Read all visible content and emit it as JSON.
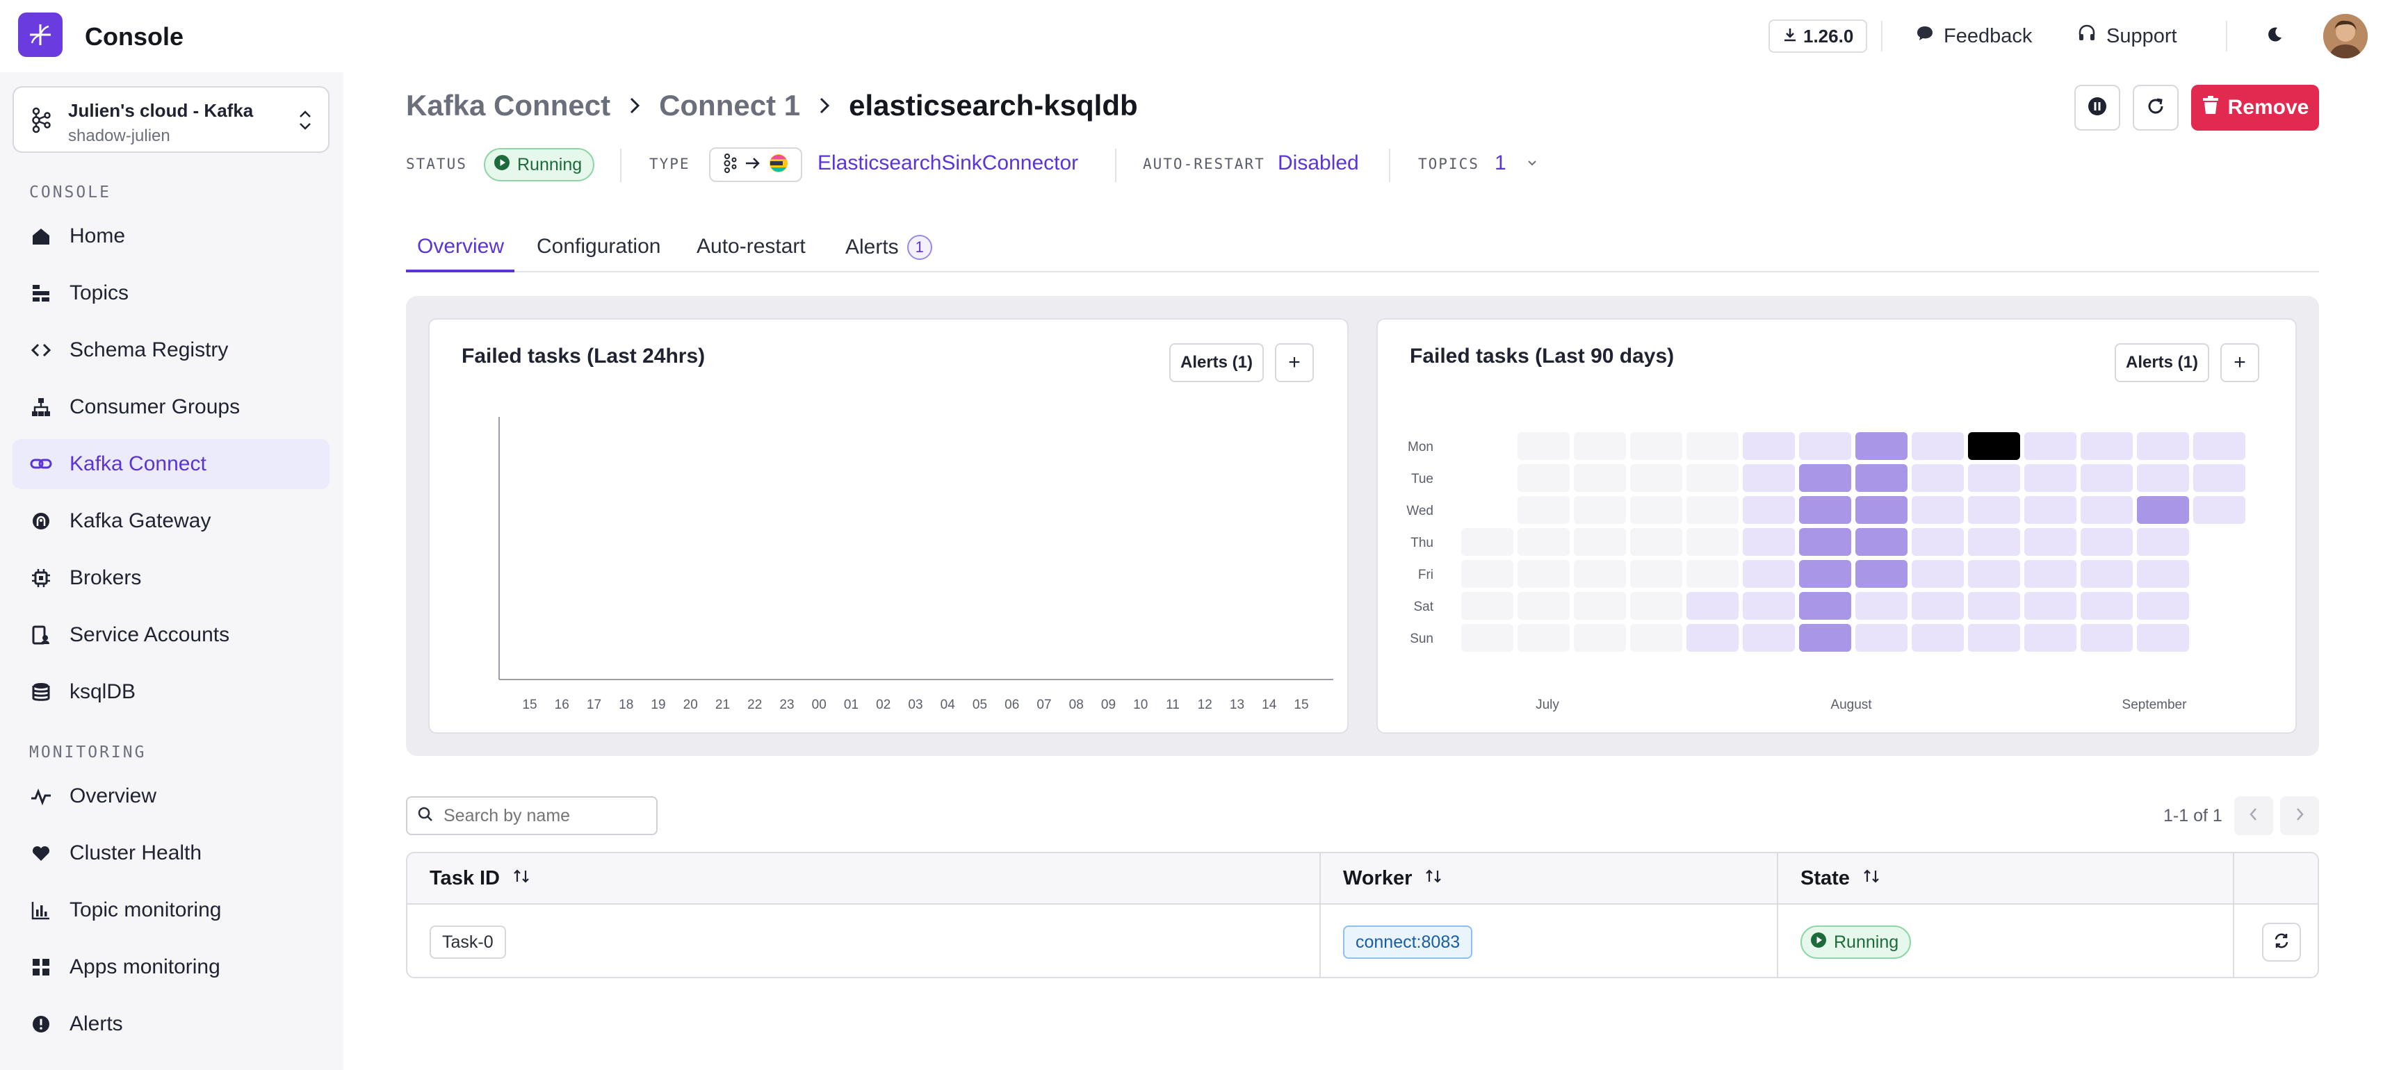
{
  "app": {
    "title": "Console"
  },
  "topbar": {
    "version": "1.26.0",
    "feedback": "Feedback",
    "support": "Support"
  },
  "cluster": {
    "name": "Julien's cloud - Kafka",
    "sub": "shadow-julien"
  },
  "sidebar": {
    "console_section": "CONSOLE",
    "console_items": [
      {
        "label": "Home",
        "icon": "home-icon"
      },
      {
        "label": "Topics",
        "icon": "topics-icon"
      },
      {
        "label": "Schema Registry",
        "icon": "code-icon"
      },
      {
        "label": "Consumer Groups",
        "icon": "hierarchy-icon"
      },
      {
        "label": "Kafka Connect",
        "icon": "link-icon",
        "active": true
      },
      {
        "label": "Kafka Gateway",
        "icon": "gateway-icon"
      },
      {
        "label": "Brokers",
        "icon": "chip-icon"
      },
      {
        "label": "Service Accounts",
        "icon": "account-icon"
      },
      {
        "label": "ksqlDB",
        "icon": "database-icon"
      }
    ],
    "monitoring_section": "MONITORING",
    "monitoring_items": [
      {
        "label": "Overview",
        "icon": "pulse-icon"
      },
      {
        "label": "Cluster Health",
        "icon": "heart-icon"
      },
      {
        "label": "Topic monitoring",
        "icon": "bar-chart-icon"
      },
      {
        "label": "Apps monitoring",
        "icon": "grid-icon"
      },
      {
        "label": "Alerts",
        "icon": "alert-icon"
      }
    ]
  },
  "breadcrumb": {
    "root": "Kafka Connect",
    "parent": "Connect 1",
    "current": "elasticsearch-ksqldb"
  },
  "header_actions": {
    "remove": "Remove"
  },
  "meta": {
    "status_label": "STATUS",
    "status_value": "Running",
    "type_label": "TYPE",
    "type_value": "ElasticsearchSinkConnector",
    "autorestart_label": "AUTO-RESTART",
    "autorestart_value": "Disabled",
    "topics_label": "TOPICS",
    "topics_value": "1"
  },
  "tabs": [
    {
      "label": "Overview",
      "active": true
    },
    {
      "label": "Configuration"
    },
    {
      "label": "Auto-restart"
    },
    {
      "label": "Alerts",
      "badge": "1"
    }
  ],
  "chart24": {
    "title": "Failed tasks (Last 24hrs)",
    "alerts_btn": "Alerts (1)",
    "add_btn": "+"
  },
  "chart90": {
    "title": "Failed tasks (Last 90 days)",
    "alerts_btn": "Alerts (1)",
    "add_btn": "+"
  },
  "chart_data": [
    {
      "type": "line",
      "title": "Failed tasks (Last 24hrs)",
      "x": [
        "15",
        "16",
        "17",
        "18",
        "19",
        "20",
        "21",
        "22",
        "23",
        "00",
        "01",
        "02",
        "03",
        "04",
        "05",
        "06",
        "07",
        "08",
        "09",
        "10",
        "11",
        "12",
        "13",
        "14",
        "15"
      ],
      "series": []
    },
    {
      "type": "heatmap",
      "title": "Failed tasks (Last 90 days)",
      "rows": [
        "Mon",
        "Tue",
        "Wed",
        "Thu",
        "Fri",
        "Sat",
        "Sun"
      ],
      "month_labels": [
        "July",
        "August",
        "September"
      ],
      "weeks": 14,
      "levels": [
        [
          null,
          0,
          0,
          0,
          0,
          1,
          1,
          2,
          1,
          4,
          1,
          1,
          1,
          1
        ],
        [
          null,
          0,
          0,
          0,
          0,
          1,
          2,
          2,
          1,
          1,
          1,
          1,
          1,
          1
        ],
        [
          null,
          0,
          0,
          0,
          0,
          1,
          2,
          2,
          1,
          1,
          1,
          1,
          2,
          1
        ],
        [
          0,
          0,
          0,
          0,
          0,
          1,
          2,
          2,
          1,
          1,
          1,
          1,
          1,
          null
        ],
        [
          0,
          0,
          0,
          0,
          0,
          1,
          2,
          2,
          1,
          1,
          1,
          1,
          1,
          null
        ],
        [
          0,
          0,
          0,
          0,
          1,
          1,
          2,
          1,
          1,
          1,
          1,
          1,
          1,
          null
        ],
        [
          0,
          0,
          0,
          0,
          1,
          1,
          2,
          1,
          1,
          1,
          1,
          1,
          1,
          null
        ]
      ],
      "colors": [
        "#f5f4f7",
        "#e8e2fa",
        "#a996e6",
        "#4f2ab8"
      ]
    }
  ],
  "search": {
    "placeholder": "Search by name"
  },
  "pager": {
    "text": "1-1 of 1"
  },
  "table": {
    "headers": [
      "Task ID",
      "Worker",
      "State"
    ],
    "rows": [
      {
        "task": "Task-0",
        "worker": "connect:8083",
        "state": "Running"
      }
    ]
  }
}
